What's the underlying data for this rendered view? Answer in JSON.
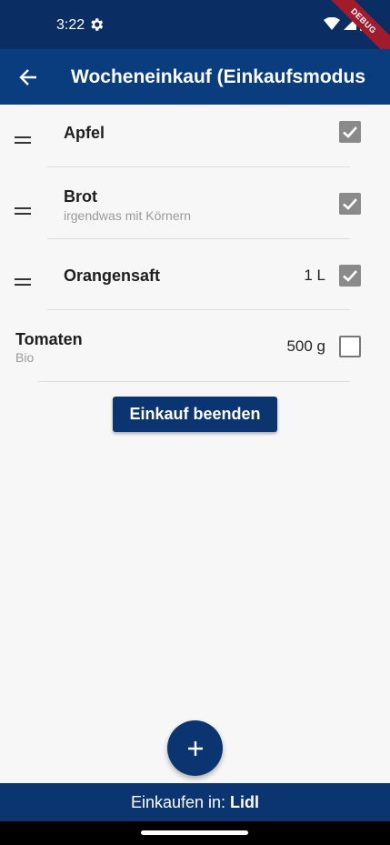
{
  "status_bar": {
    "time": "3:22",
    "debug_label": "DEBUG"
  },
  "app_bar": {
    "title": "Wocheneinkauf (Einkaufsmodus"
  },
  "items": [
    {
      "name": "Apfel",
      "subtitle": "",
      "quantity": "",
      "checked": true
    },
    {
      "name": "Brot",
      "subtitle": "irgendwas mit Körnern",
      "quantity": "",
      "checked": true
    },
    {
      "name": "Orangensaft",
      "subtitle": "",
      "quantity": "1 L",
      "checked": true
    },
    {
      "name": "Tomaten",
      "subtitle": "Bio",
      "quantity": "500 g",
      "checked": false
    }
  ],
  "finish_button": {
    "label": "Einkauf beenden"
  },
  "bottom_bar": {
    "prefix": "Einkaufen in:",
    "store": "Lidl"
  },
  "colors": {
    "primary": "#0a3d7d",
    "status": "#0a2d63",
    "checkbox_checked": "#8a8a8a"
  }
}
